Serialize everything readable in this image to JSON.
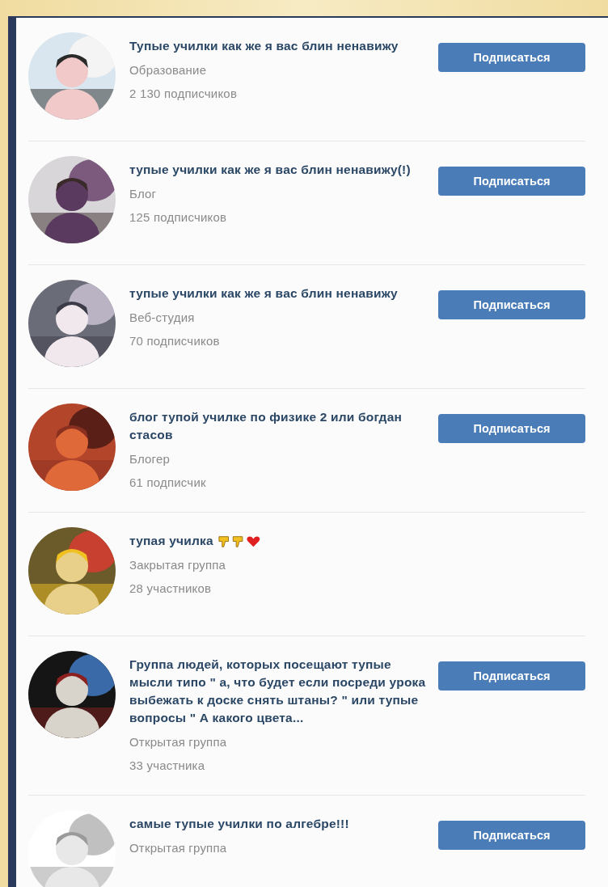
{
  "groups": [
    {
      "title": "Тупые училки как же я вас блин ненавижу",
      "category": "Образование",
      "members": "2 130 подписчиков",
      "button": "Подписаться",
      "emoji_icons": false
    },
    {
      "title": "тупые училки как же я вас блин ненавижу(!)",
      "category": "Блог",
      "members": "125 подписчиков",
      "button": "Подписаться",
      "emoji_icons": false
    },
    {
      "title": "тупые училки как же я вас блин ненавижу",
      "category": "Веб-студия",
      "members": "70 подписчиков",
      "button": "Подписаться",
      "emoji_icons": false
    },
    {
      "title": "блог тупой училке по физике 2 или богдан стасов",
      "category": "Блогер",
      "members": "61 подписчик",
      "button": "Подписаться",
      "emoji_icons": false
    },
    {
      "title": "тупая училка",
      "category": "Закрытая группа",
      "members": "28 участников",
      "emoji_icons": true
    },
    {
      "title": "Группа людей, которых посещают тупые мысли типо \" а, что будет если посреди урока выбежать к доске снять штаны? \" или тупые вопросы \" А какого цвета...",
      "category": "Открытая группа",
      "members": "33 участника",
      "button": "Подписаться",
      "emoji_icons": false
    },
    {
      "title": "самые тупые училки по алгебре!!!",
      "category": "Открытая группа",
      "button": "Подписаться",
      "emoji_icons": false
    }
  ]
}
